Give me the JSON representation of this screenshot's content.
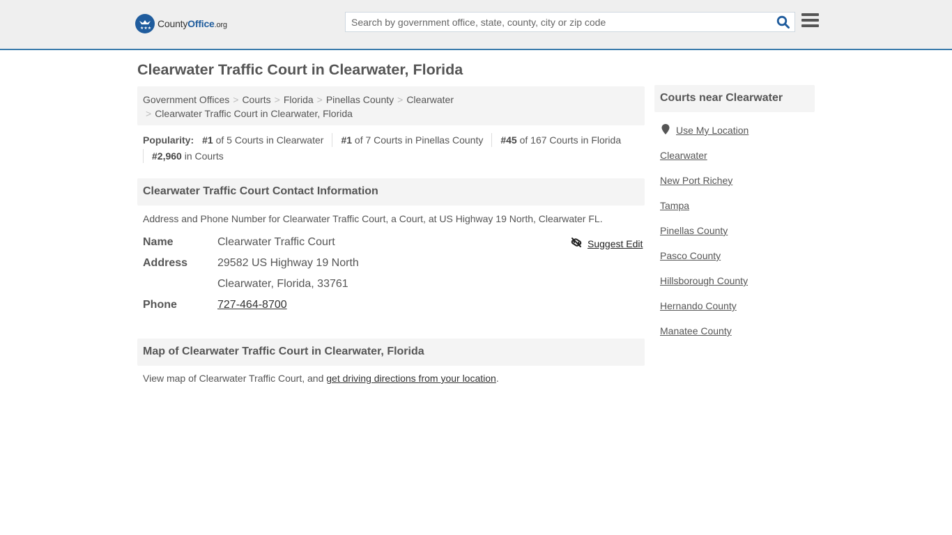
{
  "header": {
    "logo": {
      "county": "County",
      "office": "Office",
      "org": ".org"
    },
    "search": {
      "placeholder": "Search by government office, state, county, city or zip code",
      "value": ""
    },
    "icons": {
      "search": "search-icon",
      "menu": "hamburger-menu-icon"
    }
  },
  "page_title": "Clearwater Traffic Court in Clearwater, Florida",
  "breadcrumb": [
    "Government Offices",
    "Courts",
    "Florida",
    "Pinellas County",
    "Clearwater",
    "Clearwater Traffic Court in Clearwater, Florida"
  ],
  "popularity": {
    "label": "Popularity:",
    "items": [
      {
        "rank": "#1",
        "text": " of 5 Courts in Clearwater"
      },
      {
        "rank": "#1",
        "text": " of 7 Courts in Pinellas County"
      },
      {
        "rank": "#45",
        "text": " of 167 Courts in Florida"
      },
      {
        "rank": "#2,960",
        "text": " in Courts"
      }
    ]
  },
  "contact": {
    "heading": "Clearwater Traffic Court Contact Information",
    "description": "Address and Phone Number for Clearwater Traffic Court, a Court, at US Highway 19 North, Clearwater FL.",
    "suggest_edit": "Suggest Edit",
    "fields": {
      "name_label": "Name",
      "name_value": "Clearwater Traffic Court",
      "address_label": "Address",
      "address_line1": "29582 US Highway 19 North",
      "address_line2": "Clearwater, Florida, 33761",
      "phone_label": "Phone",
      "phone_value": "727-464-8700"
    }
  },
  "map": {
    "heading": "Map of Clearwater Traffic Court in Clearwater, Florida",
    "text_before": "View map of Clearwater Traffic Court, and ",
    "link": "get driving directions from your location",
    "text_after": "."
  },
  "sidebar": {
    "heading": "Courts near Clearwater",
    "use_location": "Use My Location",
    "links": [
      "Clearwater",
      "New Port Richey",
      "Tampa",
      "Pinellas County",
      "Pasco County",
      "Hillsborough County",
      "Hernando County",
      "Manatee County"
    ]
  },
  "colors": {
    "brand": "#1f5c9d",
    "header_border": "#3a7bab",
    "header_bg": "#efefef",
    "section_bg": "#f4f4f4"
  }
}
